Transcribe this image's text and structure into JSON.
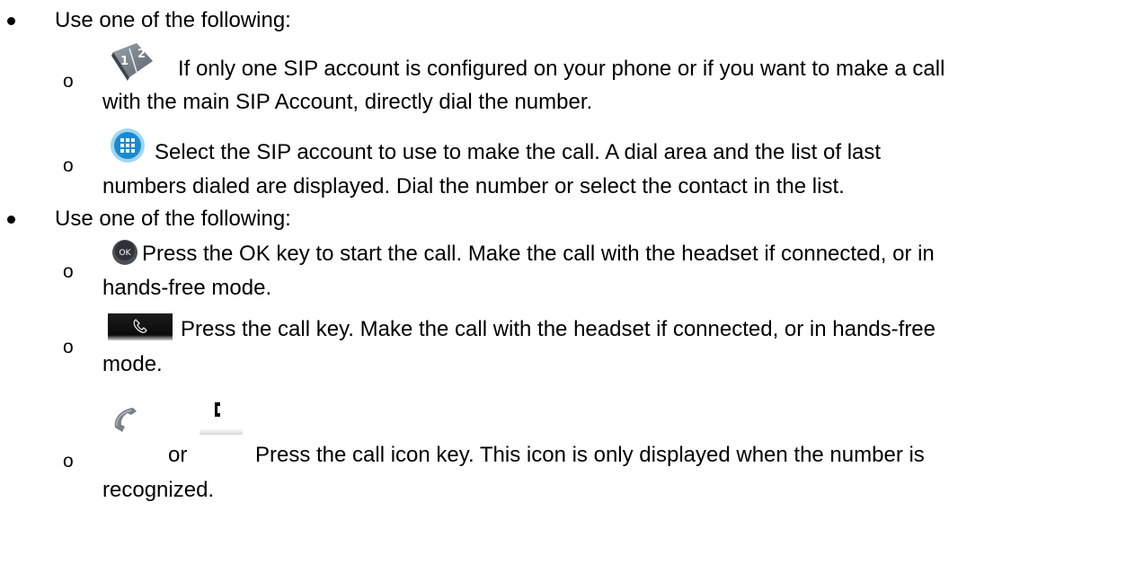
{
  "sections": [
    {
      "lead": "Use one of the following:",
      "items": [
        {
          "icon": "keypad-digits-icon",
          "lines": [
            "If only one SIP account is configured on your phone or if you want to make a call",
            "with the main SIP Account, directly dial the number."
          ]
        },
        {
          "icon": "dialpad-grid-icon",
          "lines": [
            "Select the SIP account to use to make the call. A dial area and the list of last",
            "numbers dialed are displayed. Dial the number or select the contact in the list."
          ]
        }
      ]
    },
    {
      "lead": "Use one of the following:",
      "items": [
        {
          "icon": "ok-key-icon",
          "icon_label": "OK",
          "lines": [
            "Press the OK key to start the call. Make the call with the headset if connected, or in",
            "hands-free mode."
          ]
        },
        {
          "icon": "call-key-icon",
          "lines": [
            "Press the call key. Make the call with the headset if connected, or in hands-free",
            "mode."
          ]
        },
        {
          "icon": "handset-icon",
          "alt_icon": "handset-pixel-icon",
          "connector": "or",
          "lines": [
            "Press the call icon key. This icon is only displayed when the number is",
            "recognized."
          ]
        }
      ]
    }
  ]
}
